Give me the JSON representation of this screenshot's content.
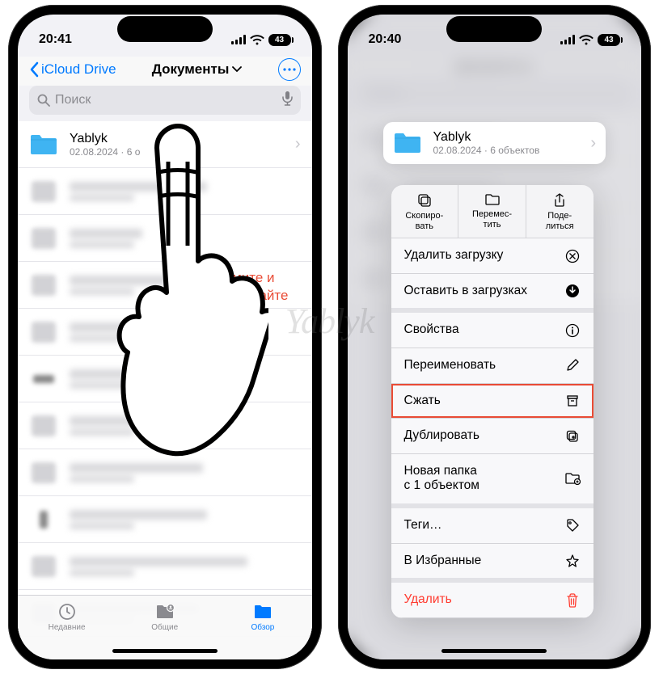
{
  "watermark": "Yablyk",
  "left": {
    "status": {
      "time": "20:41",
      "battery": "43"
    },
    "nav": {
      "back": "iCloud Drive",
      "title": "Документы"
    },
    "search_placeholder": "Поиск",
    "folder": {
      "name": "Yablyk",
      "meta": "02.08.2024 · 6 о"
    },
    "annotation": "Нажмите и удерживайте",
    "tabs": {
      "recent": "Недавние",
      "shared": "Общие",
      "browse": "Обзор"
    }
  },
  "right": {
    "status": {
      "time": "20:40",
      "battery": "43"
    },
    "folder": {
      "name": "Yablyk",
      "meta": "02.08.2024 · 6 объектов"
    },
    "top_actions": {
      "copy": "Скопиро-\nвать",
      "move": "Перемес-\nтить",
      "share": "Поде-\nлиться"
    },
    "menu": {
      "i0": "Удалить загрузку",
      "i1": "Оставить в загрузках",
      "i2": "Свойства",
      "i3": "Переименовать",
      "i4": "Сжать",
      "i5": "Дублировать",
      "i6": "Новая папка\nс 1 объектом",
      "i7": "Теги…",
      "i8": "В Избранные",
      "i9": "Удалить"
    }
  }
}
